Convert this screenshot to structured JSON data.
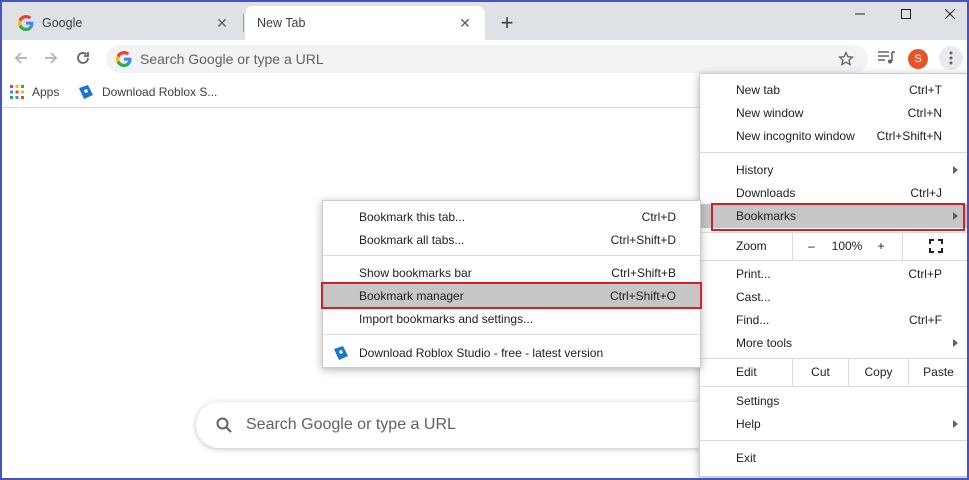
{
  "tabs": [
    {
      "title": "Google"
    },
    {
      "title": "New Tab"
    }
  ],
  "omnibox": {
    "placeholder": "Search Google or type a URL"
  },
  "profile": {
    "initial": "S"
  },
  "bookmarks_bar": [
    {
      "label": "Apps"
    },
    {
      "label": "Download Roblox S..."
    }
  ],
  "ntp": {
    "search_placeholder": "Search Google or type a URL"
  },
  "main_menu": {
    "new_tab": {
      "label": "New tab",
      "shortcut": "Ctrl+T"
    },
    "new_window": {
      "label": "New window",
      "shortcut": "Ctrl+N"
    },
    "new_incognito": {
      "label": "New incognito window",
      "shortcut": "Ctrl+Shift+N"
    },
    "history": {
      "label": "History"
    },
    "downloads": {
      "label": "Downloads",
      "shortcut": "Ctrl+J"
    },
    "bookmarks": {
      "label": "Bookmarks"
    },
    "zoom": {
      "label": "Zoom",
      "minus": "–",
      "value": "100%",
      "plus": "+"
    },
    "print": {
      "label": "Print...",
      "shortcut": "Ctrl+P"
    },
    "cast": {
      "label": "Cast..."
    },
    "find": {
      "label": "Find...",
      "shortcut": "Ctrl+F"
    },
    "more_tools": {
      "label": "More tools"
    },
    "edit": {
      "label": "Edit",
      "cut": "Cut",
      "copy": "Copy",
      "paste": "Paste"
    },
    "settings": {
      "label": "Settings"
    },
    "help": {
      "label": "Help"
    },
    "exit": {
      "label": "Exit"
    }
  },
  "bookmarks_submenu": {
    "bookmark_tab": {
      "label": "Bookmark this tab...",
      "shortcut": "Ctrl+D"
    },
    "bookmark_all": {
      "label": "Bookmark all tabs...",
      "shortcut": "Ctrl+Shift+D"
    },
    "show_bar": {
      "label": "Show bookmarks bar",
      "shortcut": "Ctrl+Shift+B"
    },
    "manager": {
      "label": "Bookmark manager",
      "shortcut": "Ctrl+Shift+O"
    },
    "import": {
      "label": "Import bookmarks and settings..."
    },
    "roblox": {
      "label": "Download Roblox Studio - free - latest version"
    }
  },
  "colors": {
    "frame": "#4a50c8",
    "highlight_box": "#d42128",
    "avatar": "#e8542a"
  }
}
